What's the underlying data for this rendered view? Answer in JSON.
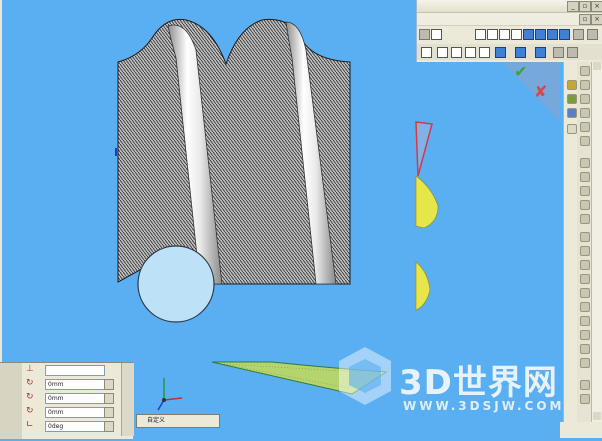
{
  "properties": {
    "rows": [
      {
        "icon": "perpendicular-axis-icon",
        "value": ""
      },
      {
        "icon": "rotate-x-icon",
        "value": "0mm"
      },
      {
        "icon": "rotate-y-icon",
        "value": "0mm"
      },
      {
        "icon": "rotate-z-icon",
        "value": "0mm"
      },
      {
        "icon": "angle-icon",
        "value": "0deg"
      }
    ]
  },
  "bottom_tab": {
    "label": "自定义"
  },
  "window_controls": {
    "minimize": "_",
    "restore": "▫",
    "close": "×"
  },
  "confirm": {
    "ok": "✔",
    "cancel": "✘"
  },
  "watermark": {
    "title": "3D世界网",
    "url": "WWW.3DSJW.COM"
  },
  "colors": {
    "viewport_bg": "#5aaef2",
    "panel_bg": "#ece9d8",
    "confirm_ok": "#3aa53a",
    "confirm_cancel": "#d44848"
  }
}
